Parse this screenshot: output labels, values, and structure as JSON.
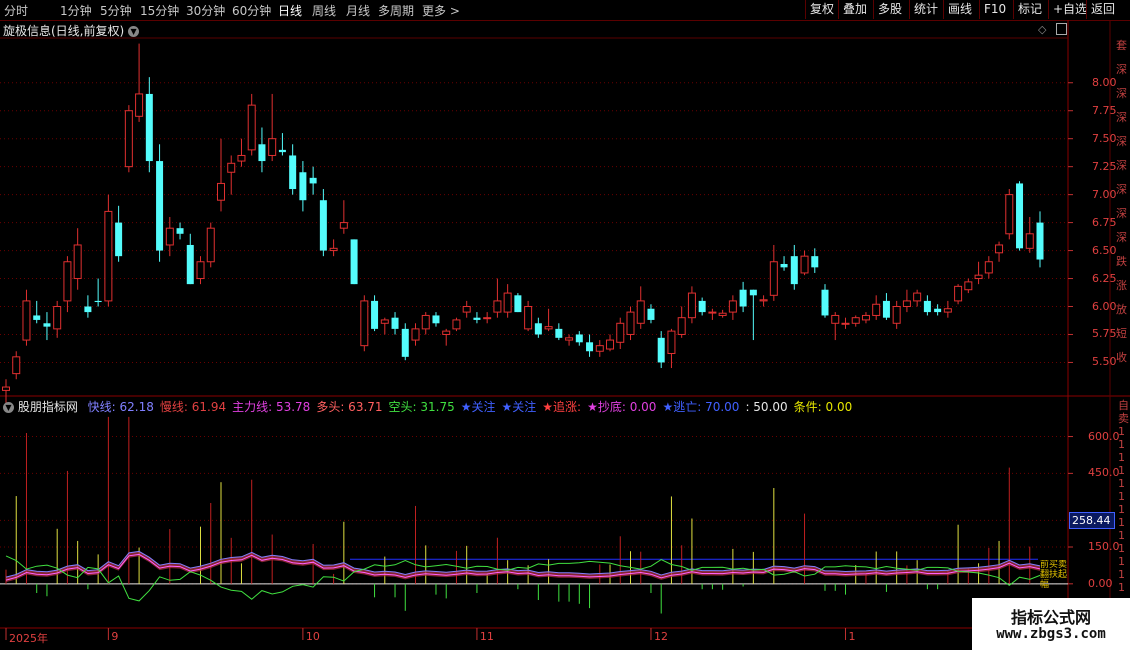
{
  "toolbar": {
    "timeframes": [
      "分时",
      "1分钟",
      "5分钟",
      "15分钟",
      "30分钟",
      "60分钟",
      "日线",
      "周线",
      "月线",
      "多周期",
      "更多"
    ],
    "active_timeframe": "日线",
    "right_buttons": [
      "复权",
      "叠加",
      "多股",
      "统计",
      "画线",
      "F10",
      "标记",
      "+自选",
      "返回"
    ]
  },
  "main_chart": {
    "title": "旋极信息(日线,前复权)",
    "y_ticks": [
      "8.00",
      "7.75",
      "7.50",
      "7.25",
      "7.00",
      "6.75",
      "6.50",
      "6.25",
      "6.00",
      "5.75",
      "5.50"
    ],
    "y_tick_values": [
      8.0,
      7.75,
      7.5,
      7.25,
      7.0,
      6.75,
      6.5,
      6.25,
      6.0,
      5.75,
      5.5
    ],
    "y_range": [
      5.2,
      8.4
    ],
    "up_color": "#e03030",
    "down_color": "#54fcfc",
    "candles": [
      {
        "o": 5.25,
        "h": 5.35,
        "l": 5.12,
        "c": 5.28
      },
      {
        "o": 5.4,
        "h": 5.6,
        "l": 5.35,
        "c": 5.55
      },
      {
        "o": 5.7,
        "h": 6.15,
        "l": 5.65,
        "c": 6.05
      },
      {
        "o": 5.92,
        "h": 6.05,
        "l": 5.85,
        "c": 5.88
      },
      {
        "o": 5.85,
        "h": 5.95,
        "l": 5.7,
        "c": 5.82
      },
      {
        "o": 5.8,
        "h": 6.05,
        "l": 5.72,
        "c": 6.0
      },
      {
        "o": 6.05,
        "h": 6.45,
        "l": 5.95,
        "c": 6.4
      },
      {
        "o": 6.25,
        "h": 6.7,
        "l": 6.15,
        "c": 6.55
      },
      {
        "o": 6.0,
        "h": 6.1,
        "l": 5.9,
        "c": 5.95
      },
      {
        "o": 6.05,
        "h": 6.25,
        "l": 6.0,
        "c": 6.04
      },
      {
        "o": 6.05,
        "h": 7.0,
        "l": 6.0,
        "c": 6.85
      },
      {
        "o": 6.75,
        "h": 6.9,
        "l": 6.4,
        "c": 6.45
      },
      {
        "o": 7.25,
        "h": 7.8,
        "l": 7.2,
        "c": 7.75
      },
      {
        "o": 7.7,
        "h": 8.35,
        "l": 7.65,
        "c": 7.9
      },
      {
        "o": 7.9,
        "h": 8.05,
        "l": 7.2,
        "c": 7.3
      },
      {
        "o": 7.3,
        "h": 7.45,
        "l": 6.4,
        "c": 6.5
      },
      {
        "o": 6.55,
        "h": 6.8,
        "l": 6.45,
        "c": 6.7
      },
      {
        "o": 6.7,
        "h": 6.75,
        "l": 6.6,
        "c": 6.65
      },
      {
        "o": 6.55,
        "h": 6.65,
        "l": 6.2,
        "c": 6.2
      },
      {
        "o": 6.25,
        "h": 6.45,
        "l": 6.2,
        "c": 6.4
      },
      {
        "o": 6.4,
        "h": 6.75,
        "l": 6.35,
        "c": 6.7
      },
      {
        "o": 6.95,
        "h": 7.5,
        "l": 6.85,
        "c": 7.1
      },
      {
        "o": 7.2,
        "h": 7.35,
        "l": 7.0,
        "c": 7.28
      },
      {
        "o": 7.3,
        "h": 7.5,
        "l": 7.25,
        "c": 7.35
      },
      {
        "o": 7.4,
        "h": 7.9,
        "l": 7.35,
        "c": 7.8
      },
      {
        "o": 7.45,
        "h": 7.6,
        "l": 7.2,
        "c": 7.3
      },
      {
        "o": 7.35,
        "h": 7.9,
        "l": 7.3,
        "c": 7.5
      },
      {
        "o": 7.4,
        "h": 7.55,
        "l": 7.35,
        "c": 7.38
      },
      {
        "o": 7.35,
        "h": 7.45,
        "l": 7.0,
        "c": 7.05
      },
      {
        "o": 7.2,
        "h": 7.3,
        "l": 6.85,
        "c": 6.95
      },
      {
        "o": 7.15,
        "h": 7.25,
        "l": 7.0,
        "c": 7.1
      },
      {
        "o": 6.95,
        "h": 7.05,
        "l": 6.45,
        "c": 6.5
      },
      {
        "o": 6.5,
        "h": 6.6,
        "l": 6.45,
        "c": 6.52
      },
      {
        "o": 6.7,
        "h": 6.95,
        "l": 6.65,
        "c": 6.75
      },
      {
        "o": 6.6,
        "h": 6.6,
        "l": 6.2,
        "c": 6.2
      },
      {
        "o": 5.65,
        "h": 6.1,
        "l": 5.6,
        "c": 6.05
      },
      {
        "o": 6.05,
        "h": 6.1,
        "l": 5.78,
        "c": 5.8
      },
      {
        "o": 5.85,
        "h": 5.9,
        "l": 5.75,
        "c": 5.88
      },
      {
        "o": 5.9,
        "h": 5.95,
        "l": 5.75,
        "c": 5.8
      },
      {
        "o": 5.8,
        "h": 5.85,
        "l": 5.52,
        "c": 5.55
      },
      {
        "o": 5.7,
        "h": 5.85,
        "l": 5.65,
        "c": 5.8
      },
      {
        "o": 5.8,
        "h": 5.95,
        "l": 5.75,
        "c": 5.92
      },
      {
        "o": 5.92,
        "h": 5.95,
        "l": 5.82,
        "c": 5.85
      },
      {
        "o": 5.75,
        "h": 5.8,
        "l": 5.65,
        "c": 5.78
      },
      {
        "o": 5.8,
        "h": 5.9,
        "l": 5.78,
        "c": 5.88
      },
      {
        "o": 5.95,
        "h": 6.05,
        "l": 5.9,
        "c": 6.0
      },
      {
        "o": 5.9,
        "h": 5.95,
        "l": 5.85,
        "c": 5.88
      },
      {
        "o": 5.9,
        "h": 5.95,
        "l": 5.85,
        "c": 5.9
      },
      {
        "o": 5.95,
        "h": 6.25,
        "l": 5.9,
        "c": 6.05
      },
      {
        "o": 5.95,
        "h": 6.2,
        "l": 5.9,
        "c": 6.12
      },
      {
        "o": 6.1,
        "h": 6.12,
        "l": 5.95,
        "c": 5.95
      },
      {
        "o": 5.8,
        "h": 6.05,
        "l": 5.78,
        "c": 6.0
      },
      {
        "o": 5.85,
        "h": 5.9,
        "l": 5.72,
        "c": 5.75
      },
      {
        "o": 5.8,
        "h": 5.98,
        "l": 5.78,
        "c": 5.82
      },
      {
        "o": 5.8,
        "h": 5.85,
        "l": 5.7,
        "c": 5.72
      },
      {
        "o": 5.7,
        "h": 5.75,
        "l": 5.65,
        "c": 5.72
      },
      {
        "o": 5.75,
        "h": 5.78,
        "l": 5.65,
        "c": 5.68
      },
      {
        "o": 5.68,
        "h": 5.75,
        "l": 5.55,
        "c": 5.6
      },
      {
        "o": 5.6,
        "h": 5.7,
        "l": 5.55,
        "c": 5.65
      },
      {
        "o": 5.62,
        "h": 5.75,
        "l": 5.6,
        "c": 5.7
      },
      {
        "o": 5.68,
        "h": 5.9,
        "l": 5.62,
        "c": 5.85
      },
      {
        "o": 5.75,
        "h": 6.0,
        "l": 5.7,
        "c": 5.95
      },
      {
        "o": 5.85,
        "h": 6.18,
        "l": 5.8,
        "c": 6.05
      },
      {
        "o": 5.98,
        "h": 6.02,
        "l": 5.85,
        "c": 5.88
      },
      {
        "o": 5.72,
        "h": 5.78,
        "l": 5.45,
        "c": 5.5
      },
      {
        "o": 5.58,
        "h": 5.8,
        "l": 5.45,
        "c": 5.78
      },
      {
        "o": 5.75,
        "h": 6.0,
        "l": 5.72,
        "c": 5.9
      },
      {
        "o": 5.9,
        "h": 6.18,
        "l": 5.85,
        "c": 6.12
      },
      {
        "o": 6.05,
        "h": 6.08,
        "l": 5.92,
        "c": 5.95
      },
      {
        "o": 5.95,
        "h": 5.98,
        "l": 5.88,
        "c": 5.95
      },
      {
        "o": 5.92,
        "h": 5.97,
        "l": 5.9,
        "c": 5.94
      },
      {
        "o": 5.95,
        "h": 6.1,
        "l": 5.88,
        "c": 6.05
      },
      {
        "o": 6.15,
        "h": 6.22,
        "l": 5.95,
        "c": 6.0
      },
      {
        "o": 6.15,
        "h": 6.15,
        "l": 5.7,
        "c": 6.1
      },
      {
        "o": 6.05,
        "h": 6.1,
        "l": 6.0,
        "c": 6.06
      },
      {
        "o": 6.1,
        "h": 6.55,
        "l": 6.05,
        "c": 6.4
      },
      {
        "o": 6.38,
        "h": 6.45,
        "l": 6.32,
        "c": 6.35
      },
      {
        "o": 6.45,
        "h": 6.55,
        "l": 6.15,
        "c": 6.2
      },
      {
        "o": 6.3,
        "h": 6.5,
        "l": 6.28,
        "c": 6.45
      },
      {
        "o": 6.45,
        "h": 6.52,
        "l": 6.3,
        "c": 6.35
      },
      {
        "o": 6.15,
        "h": 6.2,
        "l": 5.9,
        "c": 5.92
      },
      {
        "o": 5.85,
        "h": 5.95,
        "l": 5.7,
        "c": 5.92
      },
      {
        "o": 5.85,
        "h": 5.9,
        "l": 5.8,
        "c": 5.85
      },
      {
        "o": 5.85,
        "h": 5.92,
        "l": 5.82,
        "c": 5.9
      },
      {
        "o": 5.88,
        "h": 5.95,
        "l": 5.85,
        "c": 5.92
      },
      {
        "o": 5.92,
        "h": 6.1,
        "l": 5.88,
        "c": 6.02
      },
      {
        "o": 6.05,
        "h": 6.12,
        "l": 5.88,
        "c": 5.9
      },
      {
        "o": 5.85,
        "h": 6.05,
        "l": 5.8,
        "c": 6.0
      },
      {
        "o": 6.0,
        "h": 6.15,
        "l": 5.95,
        "c": 6.05
      },
      {
        "o": 6.05,
        "h": 6.15,
        "l": 6.0,
        "c": 6.12
      },
      {
        "o": 6.05,
        "h": 6.1,
        "l": 5.92,
        "c": 5.95
      },
      {
        "o": 5.98,
        "h": 6.02,
        "l": 5.92,
        "c": 5.95
      },
      {
        "o": 5.95,
        "h": 6.05,
        "l": 5.9,
        "c": 5.98
      },
      {
        "o": 6.05,
        "h": 6.2,
        "l": 6.02,
        "c": 6.18
      },
      {
        "o": 6.15,
        "h": 6.25,
        "l": 6.12,
        "c": 6.22
      },
      {
        "o": 6.25,
        "h": 6.4,
        "l": 6.2,
        "c": 6.28
      },
      {
        "o": 6.3,
        "h": 6.45,
        "l": 6.25,
        "c": 6.4
      },
      {
        "o": 6.48,
        "h": 6.58,
        "l": 6.4,
        "c": 6.55
      },
      {
        "o": 6.65,
        "h": 7.05,
        "l": 6.6,
        "c": 7.0
      },
      {
        "o": 7.1,
        "h": 7.12,
        "l": 6.5,
        "c": 6.52
      },
      {
        "o": 6.52,
        "h": 6.8,
        "l": 6.48,
        "c": 6.65
      },
      {
        "o": 6.75,
        "h": 6.85,
        "l": 6.35,
        "c": 6.42
      }
    ]
  },
  "indicator": {
    "name": "股朋指标网",
    "legend": [
      {
        "label": "快线:",
        "value": "62.18",
        "color": "#8080ff"
      },
      {
        "label": "慢线:",
        "value": "61.94",
        "color": "#e04040"
      },
      {
        "label": "主力线:",
        "value": "53.78",
        "color": "#e040e0"
      },
      {
        "label": "多头:",
        "value": "63.71",
        "color": "#ff6060"
      },
      {
        "label": "空头:",
        "value": "31.75",
        "color": "#40e040"
      },
      {
        "label": "★关注",
        "value": "",
        "color": "#4060ff"
      },
      {
        "label": "★关注",
        "value": "",
        "color": "#4060ff"
      },
      {
        "label": "★追涨:",
        "value": "",
        "color": "#ff4040"
      },
      {
        "label": "★抄底:",
        "value": "0.00",
        "color": "#e040e0"
      },
      {
        "label": "★逃亡:",
        "value": "70.00",
        "color": "#4060ff"
      },
      {
        "label": ":",
        "value": "50.00",
        "color": "#e6e6e6"
      },
      {
        "label": "条件:",
        "value": "0.00",
        "color": "#e6e600"
      }
    ],
    "y_ticks": [
      "600.0",
      "450.0",
      "150.0",
      "0.00"
    ],
    "y_tick_values": [
      600,
      450,
      150,
      0
    ],
    "highlight_value": "258.44",
    "highlight_value_num": 258.44,
    "y_range": [
      -180,
      700
    ]
  },
  "x_axis": {
    "labels": [
      "2025年",
      "9",
      "10",
      "11",
      "12",
      "1"
    ],
    "label_index": [
      0,
      10,
      29,
      46,
      63,
      82
    ]
  },
  "side_text_main": [
    "套",
    "深",
    "深",
    "深",
    "深",
    "深",
    "深",
    "深",
    "深",
    "跌",
    "涨",
    "放",
    "短",
    "收"
  ],
  "side_text_ind": [
    "自",
    "卖",
    "1",
    "1",
    "1",
    "1",
    "1",
    "1",
    "1",
    "1",
    "1",
    "1",
    "1",
    "1",
    "1"
  ],
  "watermark": {
    "line1": "指标公式网",
    "line2": "www.zbgs3.com"
  },
  "badge_chars": "前买卖翻扶起幅"
}
